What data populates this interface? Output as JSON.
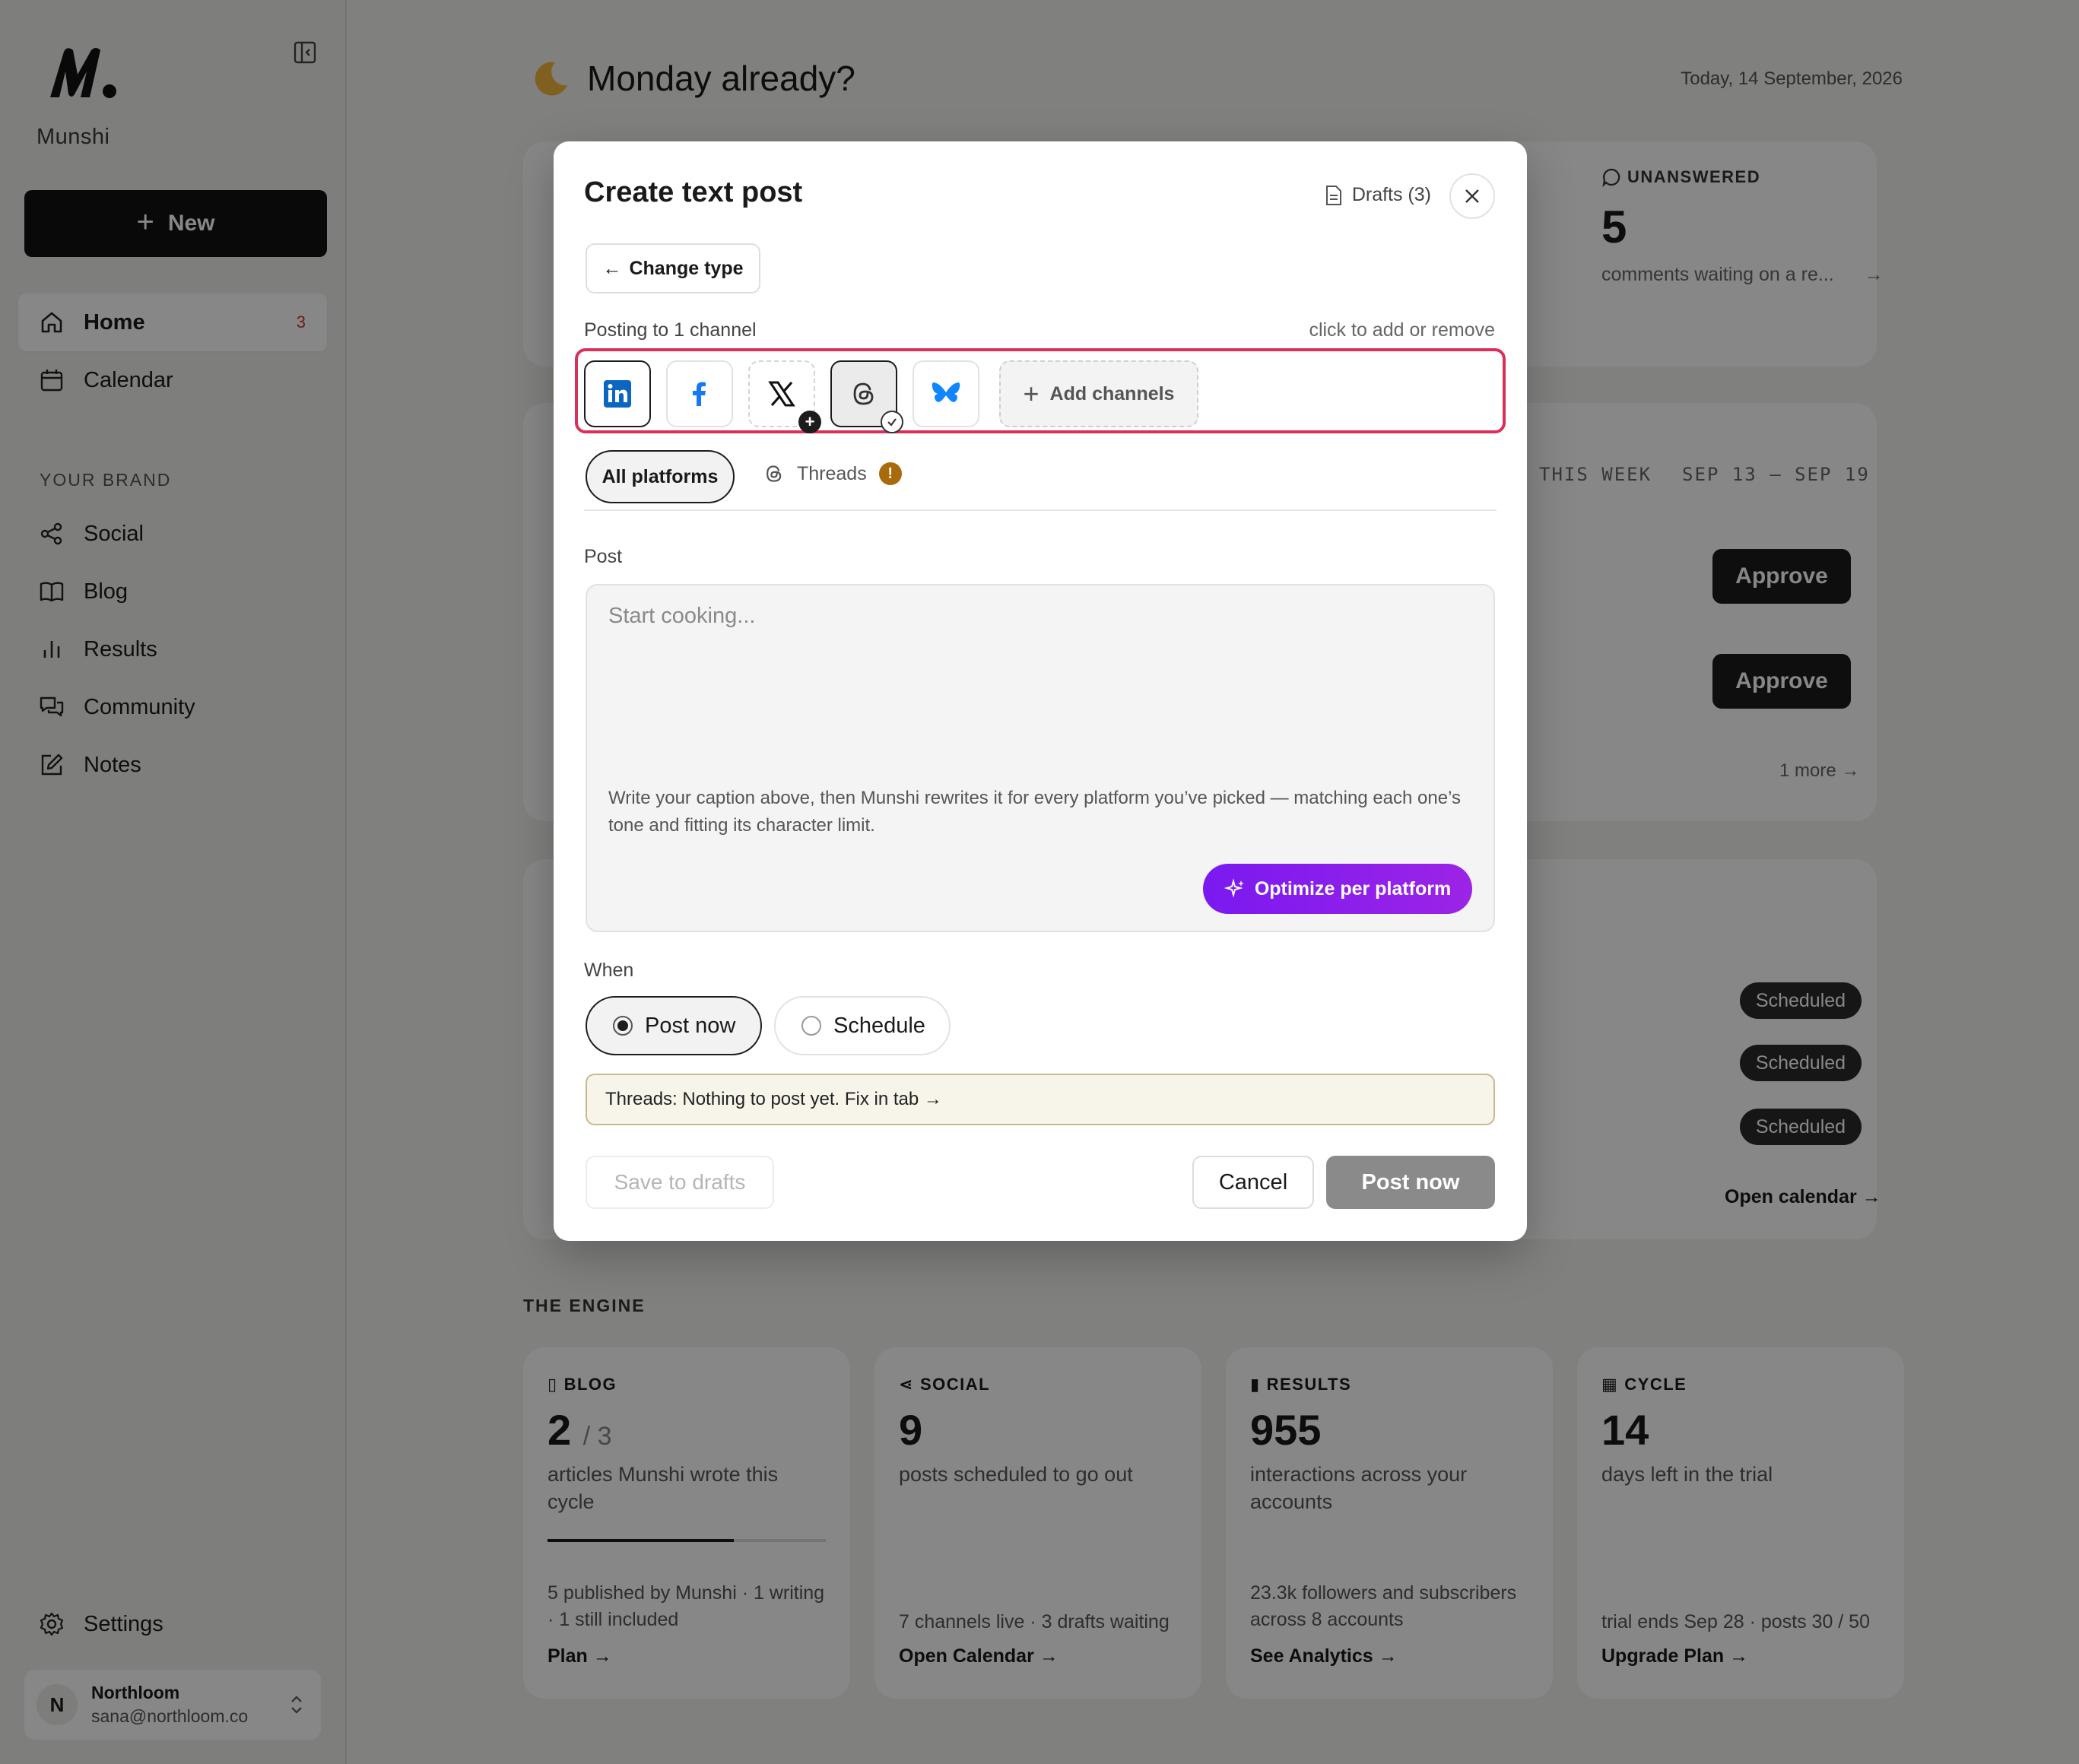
{
  "sidebar": {
    "brand": "Munshi",
    "new_label": "New",
    "nav": [
      {
        "label": "Home",
        "badge": "3",
        "icon": "home-icon"
      },
      {
        "label": "Calendar",
        "icon": "calendar-icon"
      }
    ],
    "section_label": "YOUR BRAND",
    "brand_nav": [
      {
        "label": "Social",
        "icon": "share-icon"
      },
      {
        "label": "Blog",
        "icon": "book-icon"
      },
      {
        "label": "Results",
        "icon": "bar-chart-icon"
      },
      {
        "label": "Community",
        "icon": "chat-icon"
      },
      {
        "label": "Notes",
        "icon": "edit-icon"
      }
    ],
    "settings_label": "Settings",
    "account": {
      "initial": "N",
      "name": "Northloom",
      "email": "sana@northloom.co"
    }
  },
  "main": {
    "greeting": "Monday already?",
    "today": "Today, 14 September, 2026",
    "unanswered": {
      "label": "UNANSWERED",
      "count": "5",
      "desc": "comments waiting on a re..."
    },
    "week": {
      "label": "THIS WEEK",
      "range": "SEP 13 – SEP 19"
    },
    "approve_label": "Approve",
    "more_label": "1 more",
    "scheduled_label": "Scheduled",
    "open_calendar": "Open calendar →",
    "engine_label": "THE ENGINE",
    "engine": [
      {
        "title": "BLOG",
        "num": "2",
        "sub": "/ 3",
        "desc": "articles Munshi wrote this cycle",
        "foot": "5 published by Munshi · 1 writing · 1 still included",
        "link": "Plan →",
        "progress": 0.67
      },
      {
        "title": "SOCIAL",
        "num": "9",
        "desc": "posts scheduled to go out",
        "foot": "7 channels live · 3 drafts waiting",
        "link": "Open Calendar →"
      },
      {
        "title": "RESULTS",
        "num": "955",
        "desc": "interactions across your accounts",
        "foot": "23.3k followers and subscribers across 8 accounts",
        "link": "See Analytics →"
      },
      {
        "title": "CYCLE",
        "num": "14",
        "desc": "days left in the trial",
        "foot": "trial ends Sep 28 · posts 30 / 50",
        "link": "Upgrade Plan →"
      }
    ]
  },
  "modal": {
    "title": "Create text post",
    "drafts": "Drafts (3)",
    "change_type": "Change type",
    "posting_label": "Posting to 1 channel",
    "hint": "click to add or remove",
    "add_channels": "Add channels",
    "tab_all": "All platforms",
    "tab_threads": "Threads",
    "post_label": "Post",
    "placeholder": "Start cooking...",
    "help": "Write your caption above, then Munshi rewrites it for every platform you’ve picked — matching each one’s tone and fitting its character limit.",
    "optimize": "Optimize per platform",
    "when_label": "When",
    "post_now_option": "Post now",
    "schedule_option": "Schedule",
    "notice": "Threads: Nothing to post yet. Fix in tab →",
    "save_drafts": "Save to drafts",
    "cancel": "Cancel",
    "post_now": "Post now",
    "colors": {
      "highlight": "#d9305a",
      "optimize": "#8a1ff0",
      "linkedin": "#0a66c2",
      "facebook": "#1877f2",
      "bluesky": "#1185fe"
    }
  }
}
